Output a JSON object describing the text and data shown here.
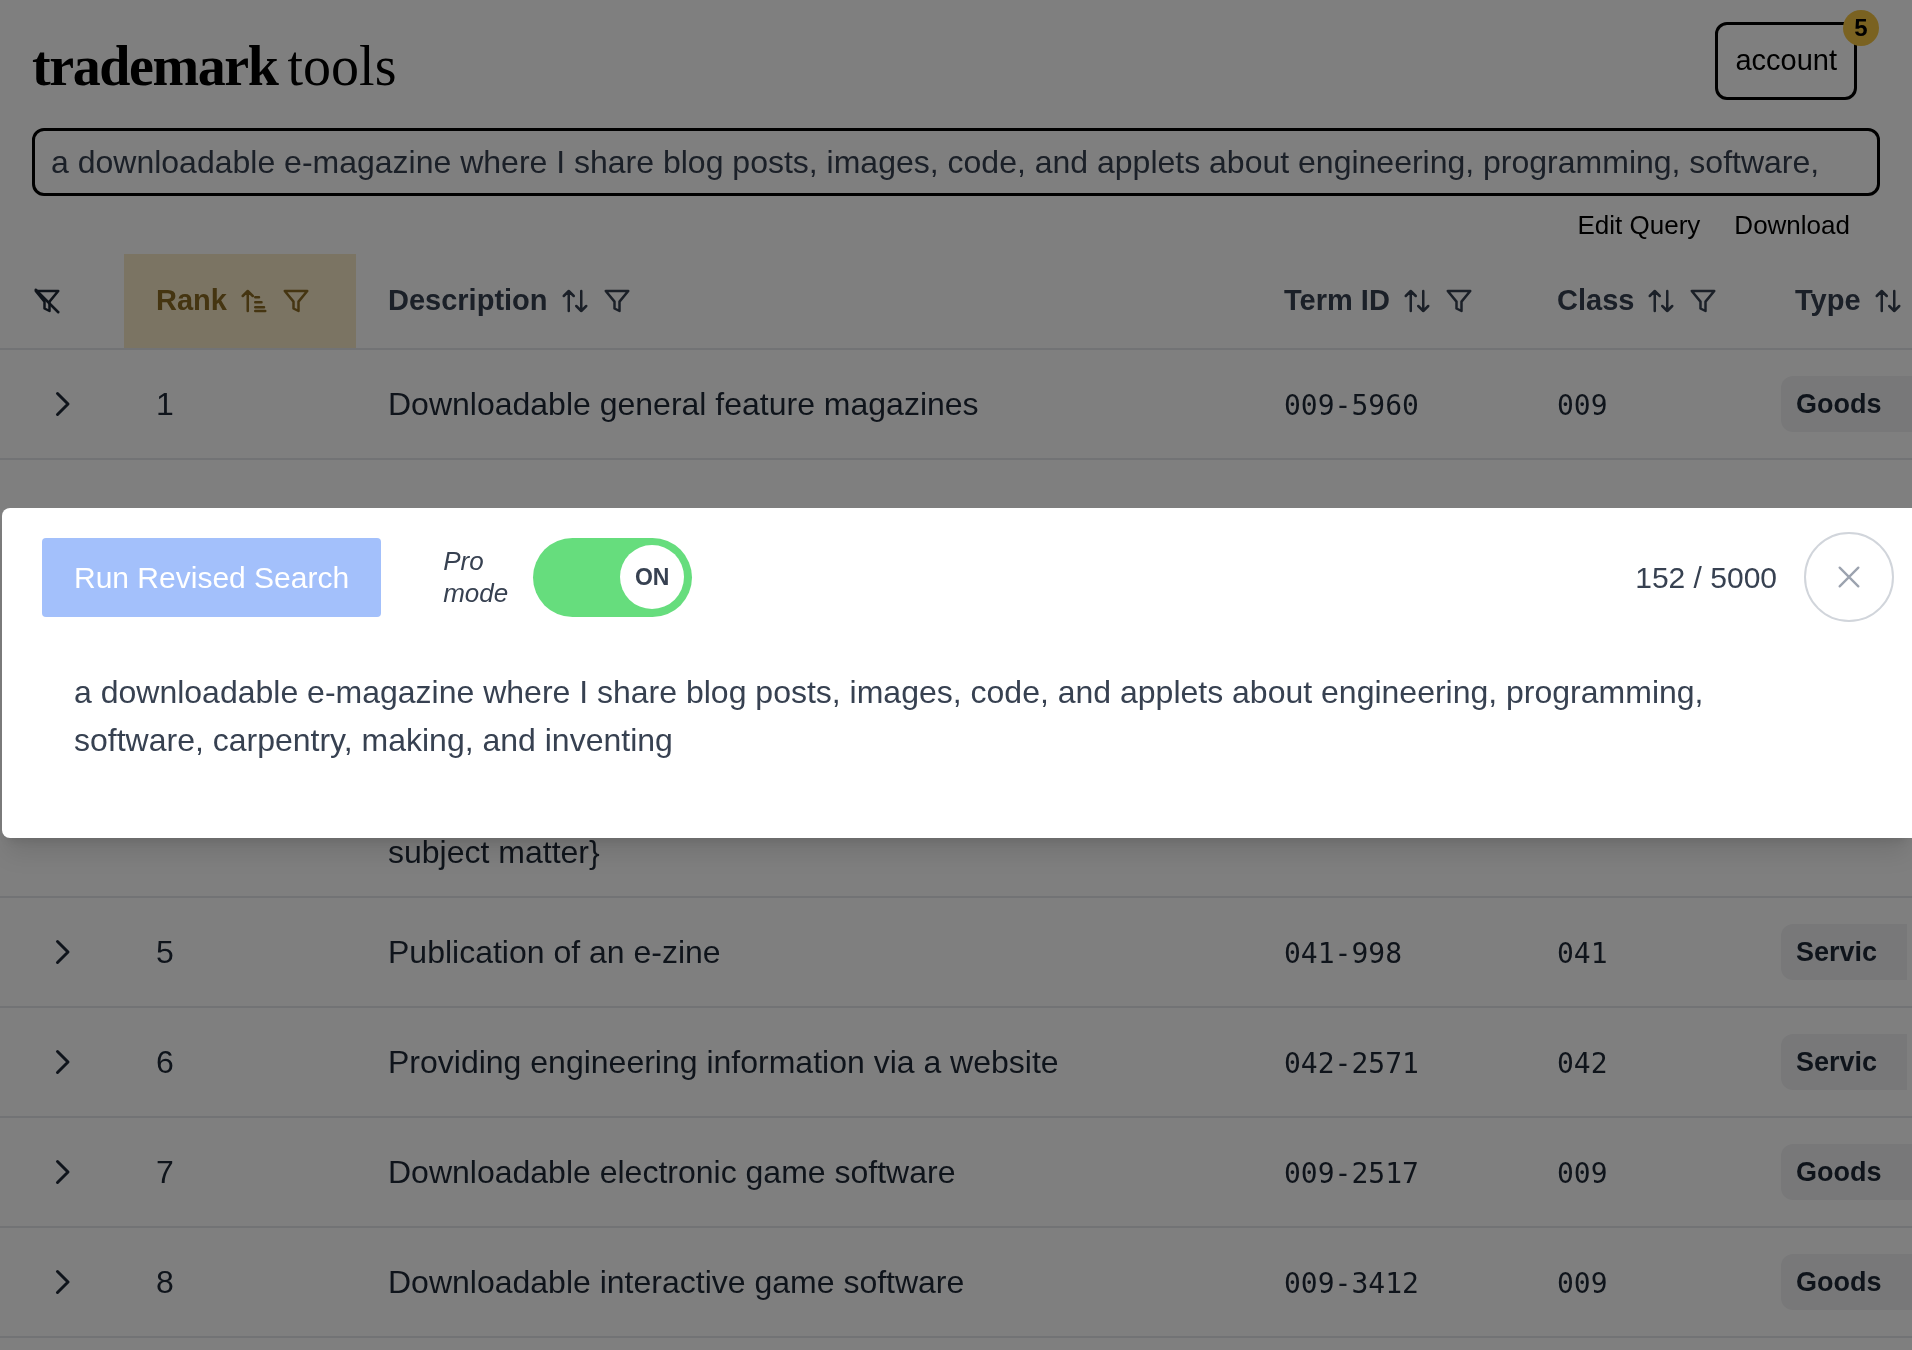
{
  "header": {
    "logo_bold": "trademark",
    "logo_regular": "tools",
    "account_button": "account",
    "notification_count": "5"
  },
  "query": {
    "value": "a downloadable e-magazine where I share blog posts, images, code, and applets about engineering, programming, software,"
  },
  "actions": [
    "Edit Query",
    "Download"
  ],
  "table": {
    "columns": [
      {
        "label": "Rank",
        "sorted": true,
        "filter": true,
        "selected": true
      },
      {
        "label": "Description",
        "sorted": false,
        "filter": true,
        "selected": false
      },
      {
        "label": "Term ID",
        "sorted": false,
        "filter": true,
        "selected": false
      },
      {
        "label": "Class",
        "sorted": false,
        "filter": true,
        "selected": false
      },
      {
        "label": "Type",
        "sorted": false,
        "filter": false,
        "selected": false
      }
    ],
    "rows": [
      {
        "kind": "row",
        "rank": "1",
        "description": "Downloadable general feature magazines",
        "term_id": "009-5960",
        "class": "009",
        "type": "Goods"
      },
      {
        "kind": "hidden",
        "description_end": "subject matter}"
      },
      {
        "kind": "row",
        "rank": "5",
        "description": "Publication of an e-zine",
        "term_id": "041-998",
        "class": "041",
        "type": "Servic"
      },
      {
        "kind": "row",
        "rank": "6",
        "description": "Providing engineering information via a website",
        "term_id": "042-2571",
        "class": "042",
        "type": "Servic"
      },
      {
        "kind": "row",
        "rank": "7",
        "description": "Downloadable electronic game software",
        "term_id": "009-2517",
        "class": "009",
        "type": "Goods"
      },
      {
        "kind": "row",
        "rank": "8",
        "description": "Downloadable interactive game software",
        "term_id": "009-3412",
        "class": "009",
        "type": "Goods"
      }
    ]
  },
  "revise_panel": {
    "run_button": {
      "label": "Run Revised Search",
      "disabled": true
    },
    "pro_mode": {
      "label": "Pro mode",
      "on": true,
      "state_label": "ON"
    },
    "counter": "152 / 5000",
    "text": "a downloadable e-magazine where I share blog posts, images, code, and applets about engineering, programming, software, carpentry, making, and inventing"
  }
}
